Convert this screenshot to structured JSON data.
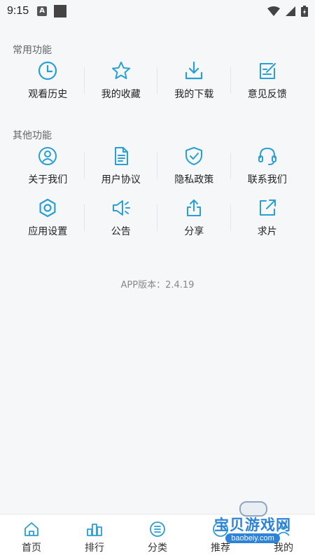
{
  "status_bar": {
    "time": "9:15",
    "notif_letter": "A"
  },
  "common": {
    "title": "常用功能",
    "items": [
      {
        "label": "观看历史",
        "icon": "clock-icon"
      },
      {
        "label": "我的收藏",
        "icon": "star-icon"
      },
      {
        "label": "我的下载",
        "icon": "download-icon"
      },
      {
        "label": "意见反馈",
        "icon": "feedback-edit-icon"
      }
    ]
  },
  "other": {
    "title": "其他功能",
    "items": [
      {
        "label": "关于我们",
        "icon": "user-icon"
      },
      {
        "label": "用户协议",
        "icon": "document-icon"
      },
      {
        "label": "隐私政策",
        "icon": "shield-check-icon"
      },
      {
        "label": "联系我们",
        "icon": "headset-icon"
      },
      {
        "label": "应用设置",
        "icon": "hexagon-settings-icon"
      },
      {
        "label": "公告",
        "icon": "megaphone-icon"
      },
      {
        "label": "分享",
        "icon": "share-icon"
      },
      {
        "label": "求片",
        "icon": "external-link-icon"
      }
    ]
  },
  "version": "APP版本：2.4.19",
  "tabbar": [
    {
      "label": "首页",
      "icon": "home-icon"
    },
    {
      "label": "排行",
      "icon": "ranking-icon"
    },
    {
      "label": "分类",
      "icon": "category-icon"
    },
    {
      "label": "推荐",
      "icon": "recommend-icon"
    },
    {
      "label": "我的",
      "icon": "profile-icon"
    }
  ],
  "watermark": {
    "text": "宝贝游戏网",
    "url": "baobeiy.com"
  },
  "colors": {
    "accent": "#2a9fd6",
    "background": "#f6f7f9"
  }
}
